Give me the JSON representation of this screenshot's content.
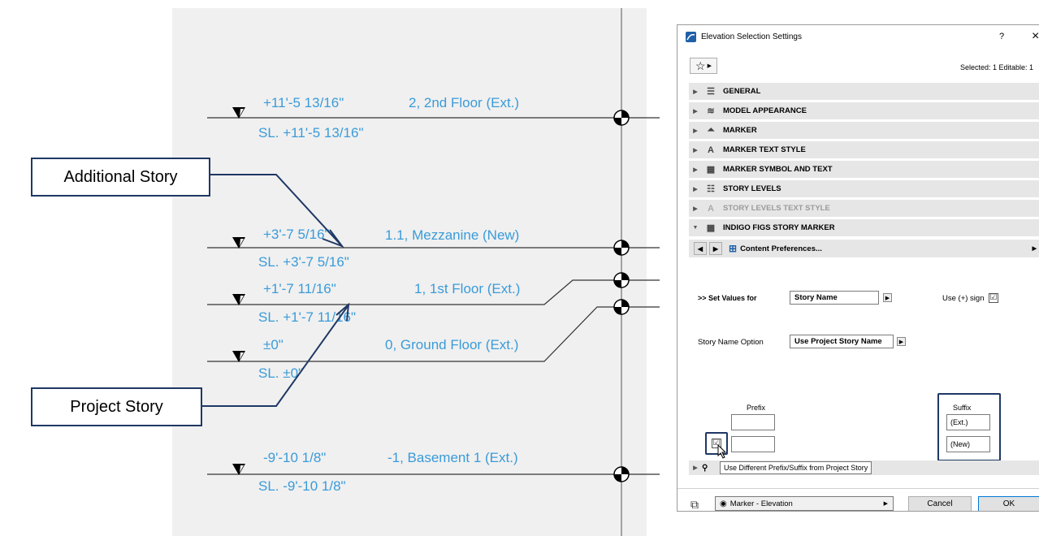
{
  "elevation": {
    "levels": [
      {
        "elev": "+11'-5 13/16\"",
        "story": "2,  2nd Floor (Ext.)",
        "sl": "SL. +11'-5 13/16\""
      },
      {
        "elev": "+3'-7 5/16\"",
        "story": "1.1,  Mezzanine (New)",
        "sl": "SL. +3'-7 5/16\""
      },
      {
        "elev": "+1'-7 11/16\"",
        "story": "1,  1st Floor (Ext.)",
        "sl": "SL. +1'-7 11/16\""
      },
      {
        "elev": "±0\"",
        "story": "0,  Ground Floor (Ext.)",
        "sl": "SL. ±0\""
      },
      {
        "elev": "-9'-10 1/8\"",
        "story": "-1,  Basement 1 (Ext.)",
        "sl": "SL. -9'-10 1/8\""
      }
    ]
  },
  "callouts": {
    "additional": "Additional Story",
    "project": "Project Story"
  },
  "dialog": {
    "title": "Elevation Selection Settings",
    "help": "?",
    "close": "×",
    "selected": "Selected: 1 Editable: 1",
    "favorites_icon": "star-icon",
    "panels": [
      {
        "label": "GENERAL",
        "icon": "general-icon",
        "state": "collapsed"
      },
      {
        "label": "MODEL APPEARANCE",
        "icon": "model-appearance-icon",
        "state": "collapsed"
      },
      {
        "label": "MARKER",
        "icon": "marker-icon",
        "state": "collapsed"
      },
      {
        "label": "MARKER TEXT STYLE",
        "icon": "text-style-icon",
        "state": "collapsed"
      },
      {
        "label": "MARKER SYMBOL AND TEXT",
        "icon": "symbol-icon",
        "state": "collapsed"
      },
      {
        "label": "STORY LEVELS",
        "icon": "story-levels-icon",
        "state": "collapsed"
      },
      {
        "label": "STORY LEVELS TEXT STYLE",
        "icon": "text-style-icon",
        "state": "disabled"
      },
      {
        "label": "INDIGO FIGS STORY MARKER",
        "icon": "symbol-icon",
        "state": "expanded"
      }
    ],
    "content_pref": "Content Preferences...",
    "set_values_label": ">> Set Values for",
    "set_values_value": "Story Name",
    "use_plus_label": "Use (+) sign",
    "use_plus_checked": "☑",
    "story_name_option_label": "Story Name Option",
    "story_name_option_value": "Use Project Story Name",
    "prefix_label": "Prefix",
    "suffix_label": "Suffix",
    "prefix_values": [
      "",
      ""
    ],
    "suffix_values": [
      "(Ext.)",
      "(New)"
    ],
    "diff_checkbox": "☑",
    "tooltip": "Use Different Prefix/Suffix from Project Story",
    "footer_layer": "Marker - Elevation",
    "cancel": "Cancel",
    "ok": "OK",
    "accent": "#1f3864",
    "level_color": "#3a9bd9"
  }
}
